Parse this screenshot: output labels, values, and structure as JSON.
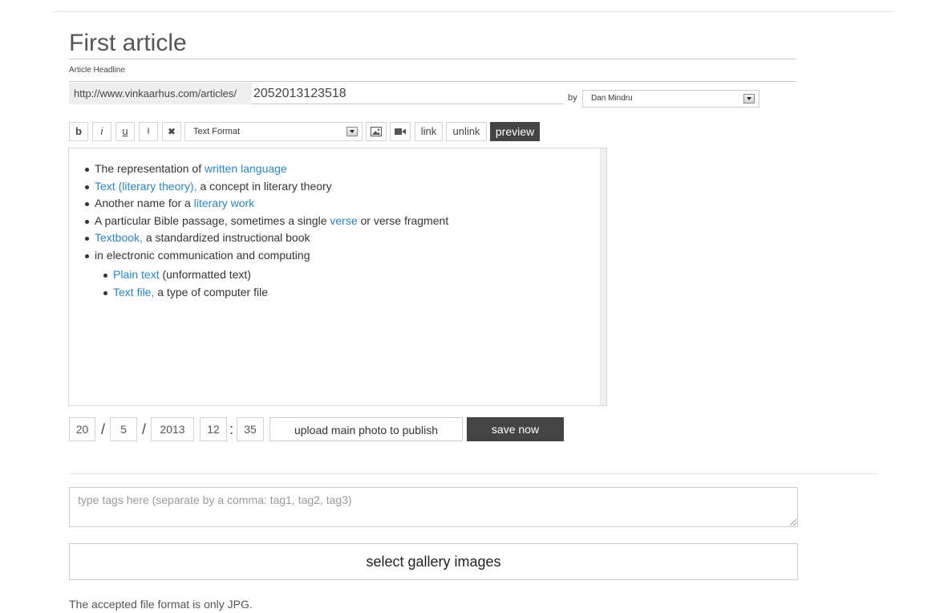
{
  "article": {
    "headline": "First article",
    "headline_caption": "Article Headline",
    "url_prefix": "http://www.vinkaarhus.com/articles/",
    "url_slug": "2052013123518",
    "by_label": "by",
    "author": "Dan Mindru"
  },
  "toolbar": {
    "bold_label": "b",
    "italic_label": "i",
    "underline_label": "u",
    "strike_label": "ł",
    "clear_label": "✖",
    "format_selected": "Text Format",
    "link_label": "link",
    "unlink_label": "unlink",
    "preview_label": "preview"
  },
  "editor": {
    "items": [
      {
        "pre": "The representation of ",
        "link": "written language",
        "post": ""
      },
      {
        "pre": "",
        "link": "Text (literary theory),",
        "post": " a concept in literary theory"
      },
      {
        "pre": "Another name for a ",
        "link": "literary work",
        "post": ""
      },
      {
        "pre": "A particular Bible passage, sometimes a single ",
        "link": "verse",
        "post": " or verse fragment"
      },
      {
        "pre": "",
        "link": "Textbook,",
        "post": " a standardized instructional book"
      },
      {
        "pre": "in electronic communication and computing",
        "link": "",
        "post": ""
      }
    ],
    "subitems": [
      {
        "pre": "",
        "link": "Plain text",
        "post": " (unformatted text)"
      },
      {
        "pre": "",
        "link": "Text file,",
        "post": " a type of computer file"
      }
    ]
  },
  "publish": {
    "day": "20",
    "month": "5",
    "year": "2013",
    "hour": "12",
    "minute": "35",
    "date_sep": "/",
    "time_sep": ":",
    "upload_label": "upload main photo to publish",
    "save_label": "save now"
  },
  "tags": {
    "placeholder": "type tags here (separate by a comma: tag1, tag2, tag3)"
  },
  "gallery": {
    "button_label": "select gallery images",
    "note": "The accepted file format is only JPG."
  },
  "colors": {
    "link": "#2a85c8",
    "dark_button": "#444444"
  }
}
